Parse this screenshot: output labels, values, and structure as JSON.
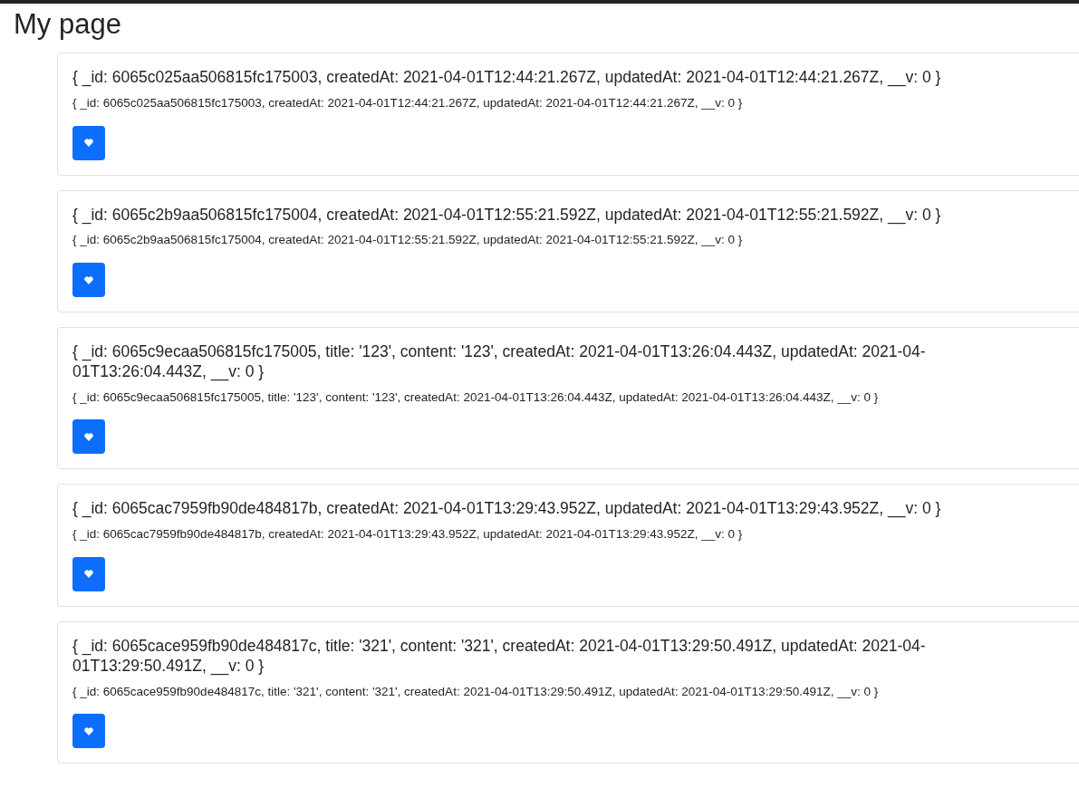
{
  "heading": "My page",
  "posts": [
    {
      "title": "{ _id: 6065c025aa506815fc175003, createdAt: 2021-04-01T12:44:21.267Z, updatedAt: 2021-04-01T12:44:21.267Z, __v: 0 }",
      "text": "{ _id: 6065c025aa506815fc175003, createdAt: 2021-04-01T12:44:21.267Z, updatedAt: 2021-04-01T12:44:21.267Z, __v: 0 }"
    },
    {
      "title": "{ _id: 6065c2b9aa506815fc175004, createdAt: 2021-04-01T12:55:21.592Z, updatedAt: 2021-04-01T12:55:21.592Z, __v: 0 }",
      "text": "{ _id: 6065c2b9aa506815fc175004, createdAt: 2021-04-01T12:55:21.592Z, updatedAt: 2021-04-01T12:55:21.592Z, __v: 0 }"
    },
    {
      "title": "{ _id: 6065c9ecaa506815fc175005, title: '123', content: '123', createdAt: 2021-04-01T13:26:04.443Z, updatedAt: 2021-04-01T13:26:04.443Z, __v: 0 }",
      "text": "{ _id: 6065c9ecaa506815fc175005, title: '123', content: '123', createdAt: 2021-04-01T13:26:04.443Z, updatedAt: 2021-04-01T13:26:04.443Z, __v: 0 }"
    },
    {
      "title": "{ _id: 6065cac7959fb90de484817b, createdAt: 2021-04-01T13:29:43.952Z, updatedAt: 2021-04-01T13:29:43.952Z, __v: 0 }",
      "text": "{ _id: 6065cac7959fb90de484817b, createdAt: 2021-04-01T13:29:43.952Z, updatedAt: 2021-04-01T13:29:43.952Z, __v: 0 }"
    },
    {
      "title": "{ _id: 6065cace959fb90de484817c, title: '321', content: '321', createdAt: 2021-04-01T13:29:50.491Z, updatedAt: 2021-04-01T13:29:50.491Z, __v: 0 }",
      "text": "{ _id: 6065cace959fb90de484817c, title: '321', content: '321', createdAt: 2021-04-01T13:29:50.491Z, updatedAt: 2021-04-01T13:29:50.491Z, __v: 0 }"
    }
  ]
}
